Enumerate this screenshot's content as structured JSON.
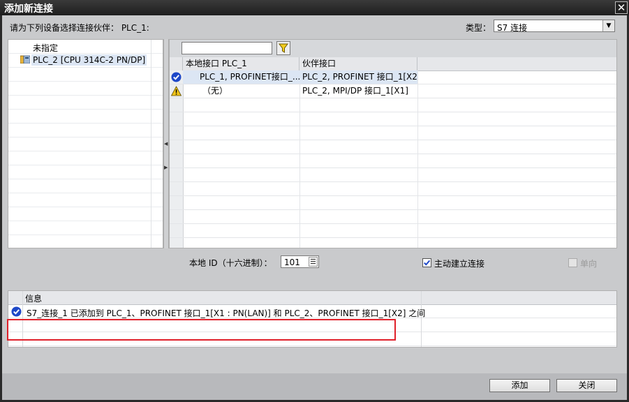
{
  "window": {
    "title": "添加新连接",
    "close_glyph": "✕"
  },
  "prompt": "请为下列设备选择连接伙伴： PLC_1:",
  "type_selector": {
    "label": "类型：",
    "value": "S7 连接"
  },
  "tree": {
    "items": [
      {
        "label": "未指定"
      },
      {
        "label": "PLC_2 [CPU 314C-2 PN/DP]",
        "icon": "plc-device-icon"
      }
    ]
  },
  "interface_grid": {
    "columns": [
      "本地接口 PLC_1",
      "伙伴接口"
    ],
    "rows": [
      {
        "status_icon": "ok-check-icon",
        "local": "PLC_1, PROFINET接口_...",
        "partner": "PLC_2, PROFINET 接口_1[X2]",
        "selected": true
      },
      {
        "status_icon": "warning-icon",
        "local": "（无）",
        "partner": "PLC_2, MPI/DP 接口_1[X1]",
        "selected": false
      }
    ]
  },
  "local_id": {
    "label": "本地 ID（十六进制）：",
    "value": "101"
  },
  "active_connection": {
    "label": "主动建立连接",
    "checked": true
  },
  "one_way": {
    "label": "单向",
    "checked": false,
    "enabled": false
  },
  "info": {
    "header": "信息",
    "message": "S7_连接_1 已添加到 PLC_1、PROFINET 接口_1[X1 : PN(LAN)] 和 PLC_2、PROFINET 接口_1[X2] 之间",
    "icon": "ok-check-icon"
  },
  "buttons": {
    "add": "添加",
    "close": "关闭"
  },
  "colors": {
    "highlight": "#e0202a",
    "selection": "#dce6f4",
    "ok_icon": "#1e48c8",
    "warning_icon": "#f0c419"
  }
}
